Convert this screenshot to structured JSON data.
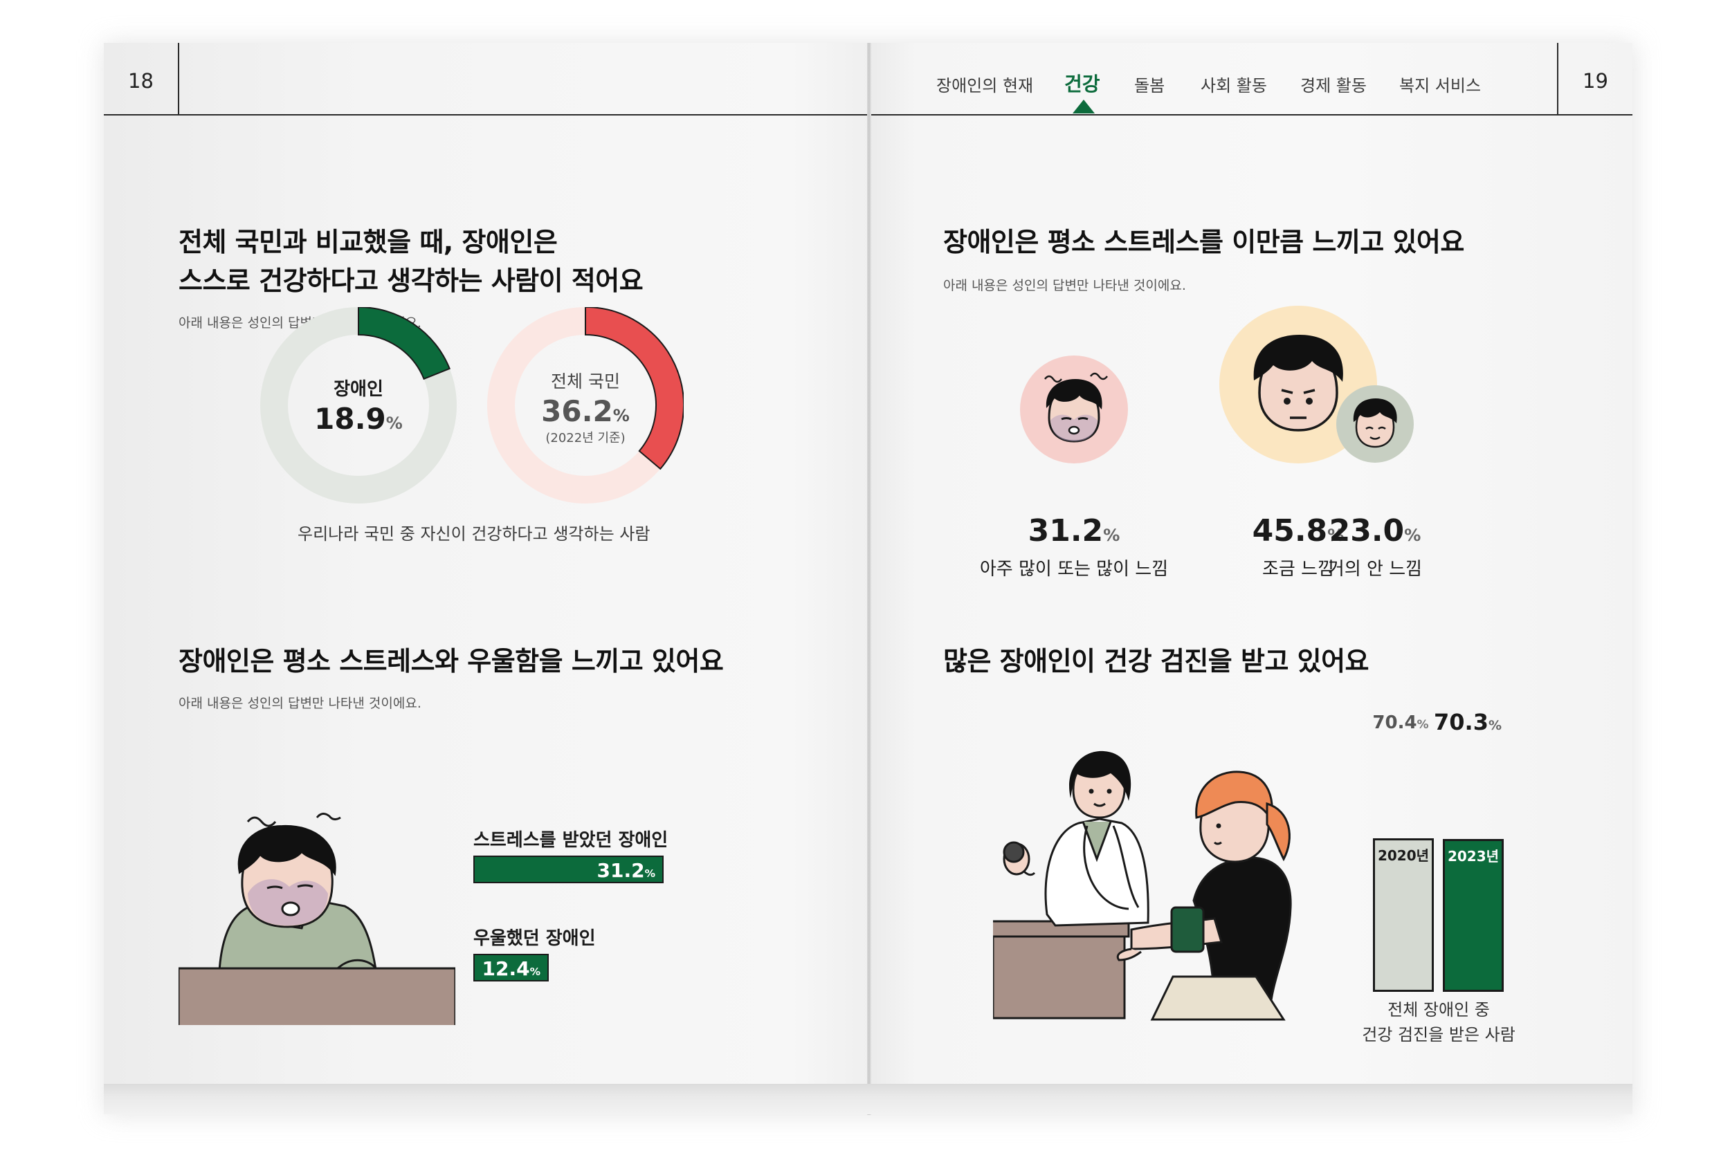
{
  "left_page": {
    "page_number": "18",
    "section1": {
      "title_line1": "전체 국민과 비교했을 때, 장애인은",
      "title_line2": "스스로 건강하다고 생각하는 사람이 적어요",
      "note": "아래 내용은 성인의 답변만 나타낸 것이에요."
    },
    "section2": {
      "title": "장애인은 평소 스트레스와 우울함을 느끼고 있어요",
      "note": "아래 내용은 성인의 답변만 나타낸 것이에요."
    }
  },
  "right_page": {
    "page_number": "19",
    "nav": {
      "tabs": [
        "장애인의 현재",
        "건강",
        "돌봄",
        "사회 활동",
        "경제 활동",
        "복지 서비스"
      ],
      "active_tab": "건강"
    },
    "section1": {
      "title": "장애인은 평소 스트레스를 이만큼 느끼고 있어요",
      "note": "아래 내용은 성인의 답변만 나타낸 것이에요."
    },
    "section2": {
      "title": "많은 장애인이 건강 검진을 받고 있어요"
    }
  },
  "chart_data": [
    {
      "type": "pie",
      "subtype": "donut",
      "caption": "우리나라 국민 중 자신이 건강하다고 생각하는 사람",
      "items": [
        {
          "label": "장애인",
          "value": 18.9,
          "display": "18.9",
          "unit": "%",
          "color": "#0c6b3c",
          "track": "#e3e7e2"
        },
        {
          "label": "전체 국민",
          "value": 36.2,
          "display": "36.2",
          "unit": "%",
          "sub": "(2022년 기준)",
          "color": "#e84f50",
          "track": "#fbe7e3"
        }
      ]
    },
    {
      "type": "bar",
      "orientation": "horizontal",
      "categories": [
        "스트레스를 받았던 장애인",
        "우울했던 장애인"
      ],
      "values": [
        31.2,
        12.4
      ],
      "display": [
        "31.2",
        "12.4"
      ],
      "unit": "%",
      "color": "#0c6b3c"
    },
    {
      "type": "bar",
      "subtype": "icon-levels",
      "categories": [
        "아주 많이 또는 많이 느낌",
        "조금 느낌",
        "거의 안 느낌"
      ],
      "values": [
        31.2,
        45.8,
        23.0
      ],
      "display": [
        "31.2",
        "45.8",
        "23.0"
      ],
      "unit": "%",
      "colors": [
        "#f6cfcb",
        "#fbe6c1",
        "#c7cfc2"
      ]
    },
    {
      "type": "bar",
      "orientation": "vertical",
      "categories": [
        "2020년",
        "2023년"
      ],
      "values": [
        70.4,
        70.3
      ],
      "display": [
        "70.4",
        "70.3"
      ],
      "unit": "%",
      "colors": [
        "#d4d9d1",
        "#0c6b3c"
      ],
      "caption_line1": "전체 장애인 중",
      "caption_line2": "건강 검진을 받은 사람"
    }
  ]
}
